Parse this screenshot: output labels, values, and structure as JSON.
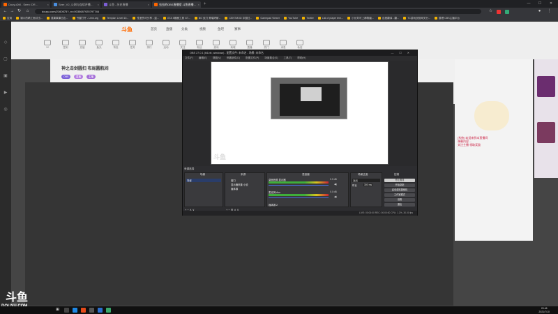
{
  "browser": {
    "tabs": [
      {
        "label": "DouyuDM - Seen: DR…",
        "active": false
      },
      {
        "label": "Seer_V2_公网与连续开播…",
        "active": false
      },
      {
        "label": "斗鱼 - 历史直播",
        "active": false
      },
      {
        "label": "虫虫的OBS直播室 斗鱼直播…",
        "active": true
      }
    ],
    "new_tab": "+",
    "url": "douyu.com/2160575?_rv=0035687925797746",
    "bookmarks": [
      "应用",
      "铜川的精工面试出...",
      "斐果果果出出...",
      "书屋打开 - Limn.org",
      "Templar: Level 10...",
      "性爱的可分享 - 盗...",
      "GTA 5服器工具 GT...",
      "BG 战刀 美瑞婷斯...",
      "CENTMOD 中国社...",
      "Gamepad Viewer",
      "YouTube",
      "Twitter",
      "List of player tem...",
      "小伙刘可上卿翔菌...",
      "百度翻译 - 翻...",
      "TC游戏战役网关分...",
      "整理 CBS主播平台"
    ]
  },
  "site": {
    "logo": "斗鱼",
    "nav": [
      "首页",
      "直播",
      "分类",
      "视频",
      "鱼吧",
      "赛事"
    ],
    "icons": [
      "12",
      "签到",
      "充值",
      "鱼丸",
      "背包",
      "任务",
      "排行",
      "活动",
      "关注",
      "粉丝",
      "游戏",
      "商城",
      "直播",
      "热门",
      "消息",
      "私信"
    ],
    "room_title": "神之击剑圆扫 布局圆航间",
    "room_tags": [
      "OBS",
      "直播",
      "主播"
    ],
    "follow_label": "+关注 0",
    "danmu": [
      "[系统] 欢迎来到本直播间",
      "弹幕内容 ...",
      "关注主播 领取奖励"
    ]
  },
  "obs": {
    "title": "OBS 27.0.1 (64-bit, windows) - 配置文件: 未命名 - 场景: 未命名",
    "menu": [
      "文件(F)",
      "编辑(E)",
      "视图(V)",
      "停靠部件(D)",
      "配置文件(P)",
      "场景集合(S)",
      "工具(T)",
      "帮助(H)"
    ],
    "preview_watermark": "斗鱼",
    "docks": {
      "scenes": {
        "title": "场景",
        "items": [
          "场景"
        ]
      },
      "sources": {
        "title": "来源",
        "items": [
          "窗口",
          "显示器采集 小说",
          "媒体源"
        ]
      },
      "mixer": {
        "title": "混音器",
        "channels": [
          "桌面音频 显示器",
          "麦克风/Aux",
          "媒体源 2"
        ],
        "levels": [
          "0.0 dB",
          "0.0 dB",
          "0.0 dB"
        ]
      },
      "transitions": {
        "title": "场景过渡",
        "items": [
          "淡出",
          "时长"
        ],
        "duration": "300 ms"
      },
      "controls": {
        "title": "控制",
        "buttons": [
          "停止推流",
          "开始录制",
          "启动虚拟摄像机",
          "工作室模式",
          "设置",
          "退出"
        ]
      }
    },
    "toolbar_label": "来源选择",
    "status": "LIVE: 00:00:00  REC: 00:00:00  CPU: 1.2%, 30.00 fps"
  },
  "stream": {
    "logo": "斗鱼",
    "url": "DOUYU.COM"
  },
  "taskbar": {
    "time": "20:46",
    "date": "2021/7/10"
  }
}
